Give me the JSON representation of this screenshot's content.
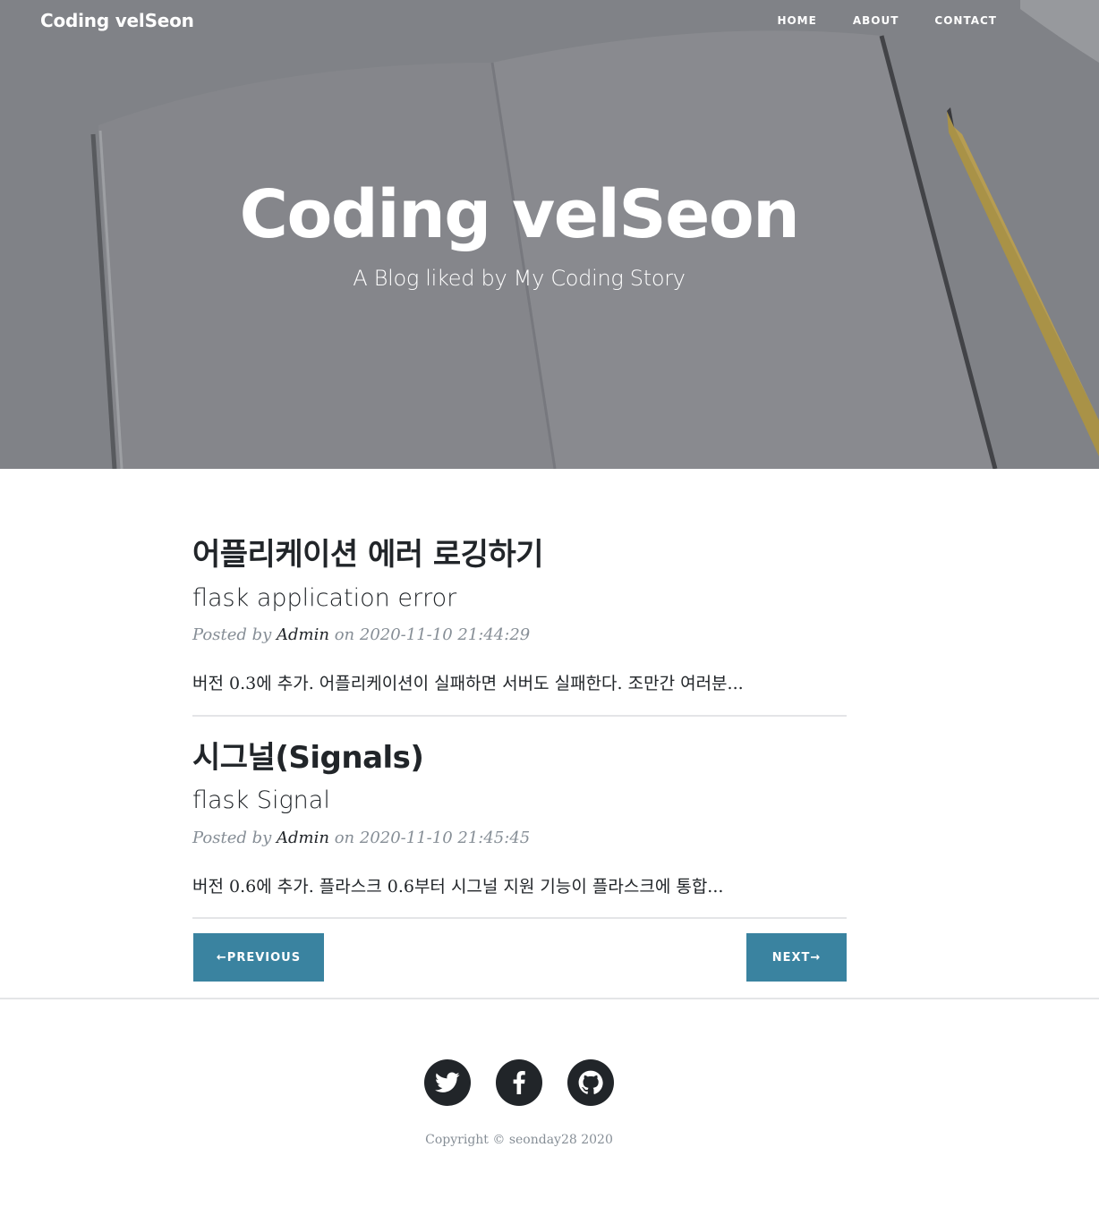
{
  "navbar": {
    "brand": "Coding velSeon",
    "links": [
      "HOME",
      "ABOUT",
      "CONTACT"
    ]
  },
  "hero": {
    "title": "Coding velSeon",
    "subtitle": "A Blog liked by My Coding Story"
  },
  "posts": [
    {
      "title": "어플리케이션 에러 로깅하기",
      "subtitle": "flask application error",
      "meta_prefix": "Posted by",
      "author": "Admin",
      "meta_on": "on",
      "date": "2020-11-10 21:44:29",
      "excerpt": "버전 0.3에 추가. 어플리케이션이 실패하면 서버도 실패한다. 조만간 여러분..."
    },
    {
      "title": "시그널(Signals)",
      "subtitle": "flask Signal",
      "meta_prefix": "Posted by",
      "author": "Admin",
      "meta_on": "on",
      "date": "2020-11-10 21:45:45",
      "excerpt": "버전 0.6에 추가. 플라스크 0.6부터 시그널 지원 기능이 플라스크에 통합..."
    }
  ],
  "pager": {
    "previous": "←PREVIOUS",
    "next": "NEXT→"
  },
  "footer": {
    "social_icons": [
      "twitter-icon",
      "facebook-icon",
      "github-icon"
    ],
    "copyright": "Copyright © seonday28 2020"
  },
  "colors": {
    "accent": "#3a83a0",
    "text": "#212529",
    "muted": "#868e96",
    "hero_bg": "#7d7f84"
  }
}
